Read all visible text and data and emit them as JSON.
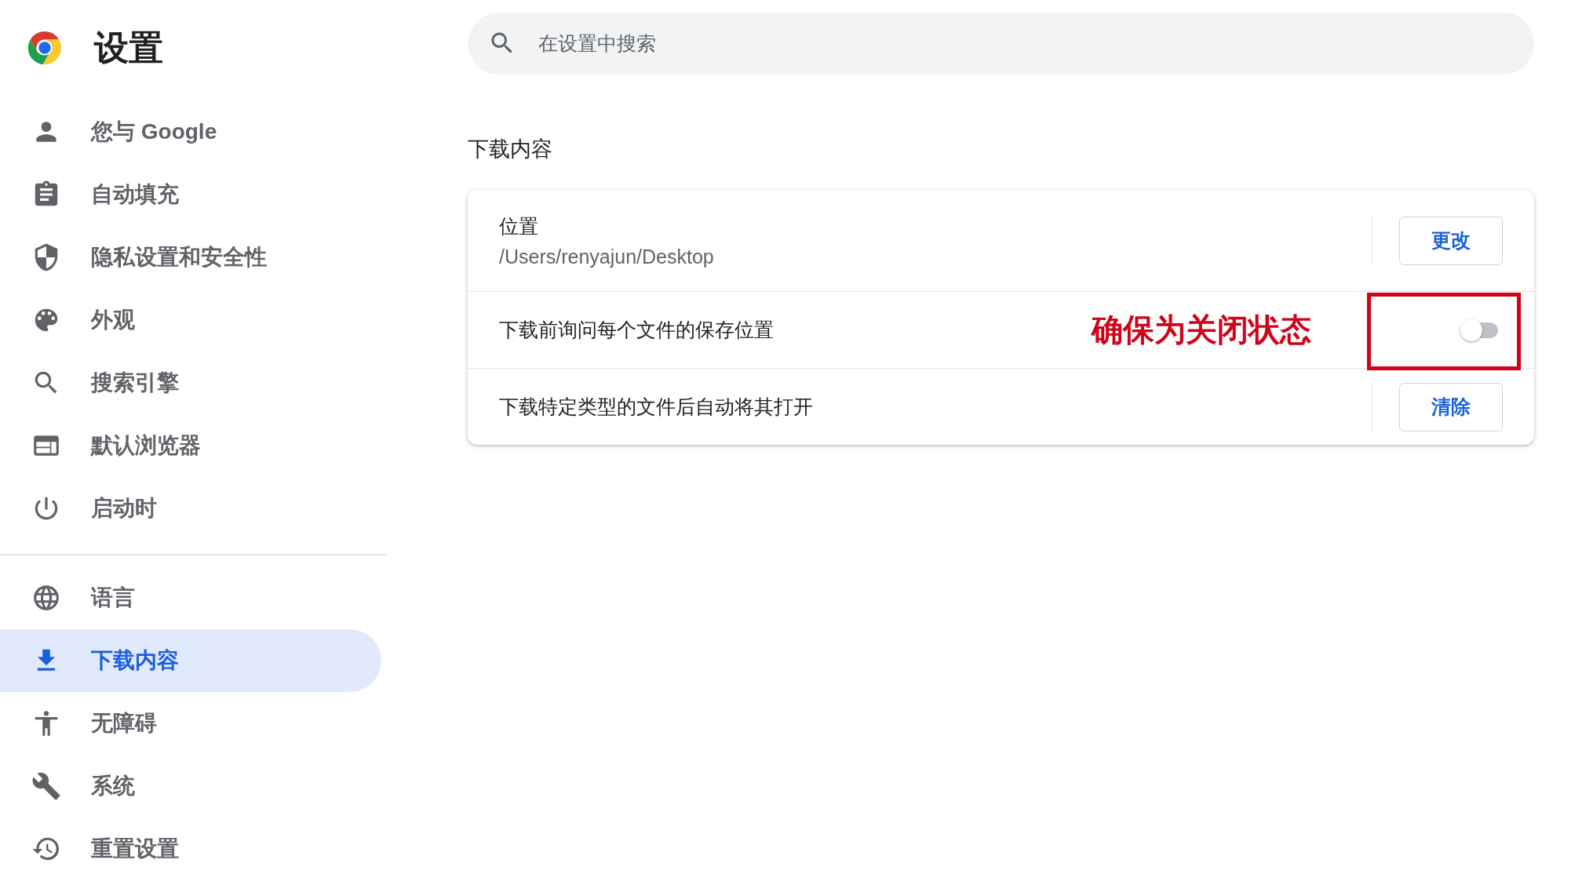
{
  "app": {
    "title": "设置"
  },
  "search": {
    "placeholder": "在设置中搜索"
  },
  "sidebar": {
    "groups": [
      {
        "items": [
          {
            "label": "您与 Google",
            "selected": false
          },
          {
            "label": "自动填充",
            "selected": false
          },
          {
            "label": "隐私设置和安全性",
            "selected": false
          },
          {
            "label": "外观",
            "selected": false
          },
          {
            "label": "搜索引擎",
            "selected": false
          },
          {
            "label": "默认浏览器",
            "selected": false
          },
          {
            "label": "启动时",
            "selected": false
          }
        ]
      },
      {
        "items": [
          {
            "label": "语言",
            "selected": false
          },
          {
            "label": "下载内容",
            "selected": true
          },
          {
            "label": "无障碍",
            "selected": false
          },
          {
            "label": "系统",
            "selected": false
          },
          {
            "label": "重置设置",
            "selected": false
          }
        ]
      }
    ]
  },
  "section": {
    "title": "下载内容",
    "rows": [
      {
        "kind": "button",
        "label": "位置",
        "value": "/Users/renyajun/Desktop",
        "button": "更改"
      },
      {
        "kind": "toggle",
        "label": "下载前询问每个文件的保存位置",
        "on": false
      },
      {
        "kind": "button",
        "label": "下载特定类型的文件后自动将其打开",
        "button": "清除"
      }
    ]
  },
  "annotation": {
    "text": "确保为关闭状态"
  }
}
